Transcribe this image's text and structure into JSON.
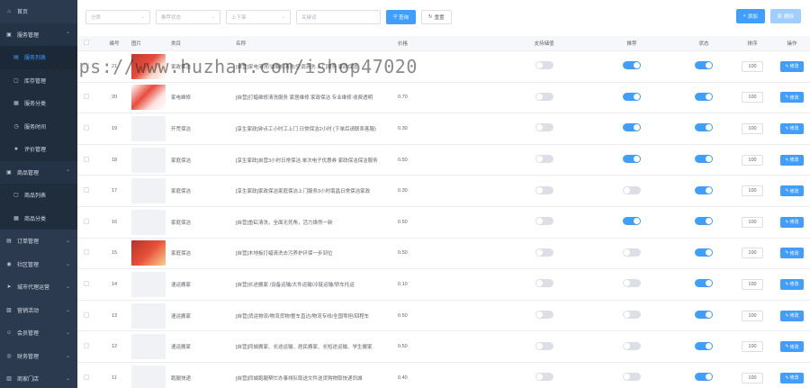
{
  "sidebar": {
    "items": [
      {
        "type": "top",
        "icon": "home-icon",
        "glyph": "⌂",
        "label": "首页"
      },
      {
        "type": "group",
        "icon": "service-icon",
        "glyph": "▣",
        "label": "服务管理",
        "open": true
      },
      {
        "type": "sub",
        "icon": "list-icon",
        "glyph": "▤",
        "label": "服务列表",
        "active": true
      },
      {
        "type": "sub",
        "icon": "stock-icon",
        "glyph": "▢",
        "label": "库存管理"
      },
      {
        "type": "sub",
        "icon": "category-icon",
        "glyph": "▦",
        "label": "服务分类"
      },
      {
        "type": "sub",
        "icon": "clock-icon",
        "glyph": "◷",
        "label": "服务时间"
      },
      {
        "type": "sub",
        "icon": "star-icon",
        "glyph": "★",
        "label": "评价管理"
      },
      {
        "type": "group",
        "icon": "goods-icon",
        "glyph": "▣",
        "label": "商品管理",
        "open": true
      },
      {
        "type": "sub",
        "icon": "bag-icon",
        "glyph": "▢",
        "label": "商品列表"
      },
      {
        "type": "sub",
        "icon": "category-icon",
        "glyph": "▦",
        "label": "商品分类"
      },
      {
        "type": "group",
        "icon": "order-icon",
        "glyph": "▤",
        "label": "订单管理"
      },
      {
        "type": "group",
        "icon": "community-icon",
        "glyph": "◉",
        "label": "社区管理"
      },
      {
        "type": "group",
        "icon": "city-icon",
        "glyph": "➤",
        "label": "城市代理运营"
      },
      {
        "type": "group",
        "icon": "marketing-icon",
        "glyph": "▨",
        "label": "营销活动"
      },
      {
        "type": "group",
        "icon": "member-icon",
        "glyph": "☺",
        "label": "会员管理"
      },
      {
        "type": "group",
        "icon": "finance-icon",
        "glyph": "◎",
        "label": "财务管理"
      },
      {
        "type": "group",
        "icon": "store-icon",
        "glyph": "▥",
        "label": "商家门店"
      }
    ]
  },
  "filters": {
    "category_placeholder": "分类",
    "recommend_placeholder": "推荐状态",
    "shelf_placeholder": "上下架",
    "keyword_placeholder": "关键词",
    "search_label": "查询",
    "reset_label": "重置"
  },
  "toolbar": {
    "add_label": "添加",
    "delete_label": "删除"
  },
  "table": {
    "headers": {
      "id": "编号",
      "image": "图片",
      "category": "类目",
      "name": "名称",
      "price": "价格",
      "support": "支持储值",
      "recommend": "推荐",
      "status": "状态",
      "sort": "排序",
      "op": "操作"
    },
    "edit_label": "修改",
    "rows": [
      {
        "id": "21",
        "img": "pic",
        "category": "家政保洁",
        "name": "[自营]家电清洗/油烟机清洗/空调清洗 上门服务 家政保洁",
        "price": "",
        "support": false,
        "recommend": true,
        "status": true,
        "sort": "100"
      },
      {
        "id": "20",
        "img": "pic2",
        "category": "家电维修",
        "name": "[自营]打蜡维修清洗服务 家居维修 家政保洁 专业维修 收费透明",
        "price": "0.70",
        "support": false,
        "recommend": true,
        "status": true,
        "sort": "100"
      },
      {
        "id": "19",
        "img": "",
        "category": "开荒保洁",
        "name": "[享生家政]钟点工小时工上门 日常保洁2小时 (下单后请联系客服)",
        "price": "0.30",
        "support": false,
        "recommend": true,
        "status": true,
        "sort": "100"
      },
      {
        "id": "18",
        "img": "",
        "category": "家庭保洁",
        "name": "[享生家政]自营3小时日常保洁 单次电子优惠券 家政保洁保洁服务",
        "price": "0.50",
        "support": false,
        "recommend": true,
        "status": true,
        "sort": "100"
      },
      {
        "id": "17",
        "img": "",
        "category": "家庭保洁",
        "name": "[享生家政]家政保洁家庭保洁上门服务3小时南昌日常保洁家政",
        "price": "0.30",
        "support": false,
        "recommend": false,
        "status": true,
        "sort": "100"
      },
      {
        "id": "16",
        "img": "",
        "category": "家庭保洁",
        "name": "[自营]鱼缸清洗，全面无死角，活力焕然一新",
        "price": "0.50",
        "support": false,
        "recommend": true,
        "status": true,
        "sort": "100"
      },
      {
        "id": "15",
        "img": "pic3",
        "category": "家庭保洁",
        "name": "[自营]木地板打蜡清洗去污养护环保一步到位",
        "price": "0.50",
        "support": false,
        "recommend": false,
        "status": true,
        "sort": "100"
      },
      {
        "id": "14",
        "img": "",
        "category": "速运搬家",
        "name": "[自营]长途搬家 /设备运输/大件运输/冷链运输/轿车托运",
        "price": "0.10",
        "support": false,
        "recommend": false,
        "status": true,
        "sort": "100"
      },
      {
        "id": "13",
        "img": "",
        "category": "速运搬家",
        "name": "[自营]货运物流/物流货物/整车直达/物流专线/全国零担/回程车",
        "price": "0.50",
        "support": false,
        "recommend": false,
        "status": true,
        "sort": "100"
      },
      {
        "id": "12",
        "img": "",
        "category": "速运搬家",
        "name": "[自营]同城搬家、长途运输、居民搬家、长短途运输、学生搬家",
        "price": "0.50",
        "support": false,
        "recommend": false,
        "status": true,
        "sort": "100"
      },
      {
        "id": "11",
        "img": "",
        "category": "跑腿快递",
        "name": "[自营]同城跑腿帮忙办事排队取送文件送货购物取快递同城",
        "price": "0.40",
        "support": false,
        "recommend": false,
        "status": true,
        "sort": "100"
      }
    ]
  },
  "watermark": "https://www.huzhan.com/ishop47020"
}
